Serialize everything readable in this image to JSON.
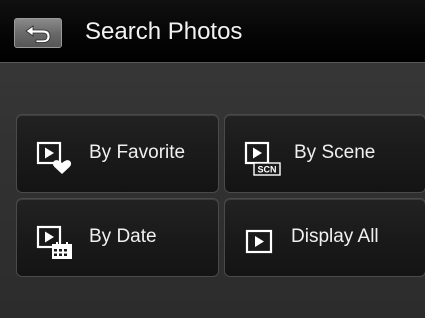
{
  "header": {
    "back_icon": "back-arrow-icon",
    "title": "Search Photos"
  },
  "menu": {
    "items": [
      {
        "label": "By Favorite",
        "icon": "play-heart-icon"
      },
      {
        "label": "By Scene",
        "icon": "play-scn-icon",
        "badge": "SCN"
      },
      {
        "label": "By Date",
        "icon": "play-calendar-icon"
      },
      {
        "label": "Display All",
        "icon": "play-icon"
      }
    ]
  },
  "colors": {
    "background": "#333333",
    "title_bar": "#050505",
    "tile": "#1a1a1a",
    "text": "#f0f0f0",
    "back_button": "#6a6a6a"
  }
}
